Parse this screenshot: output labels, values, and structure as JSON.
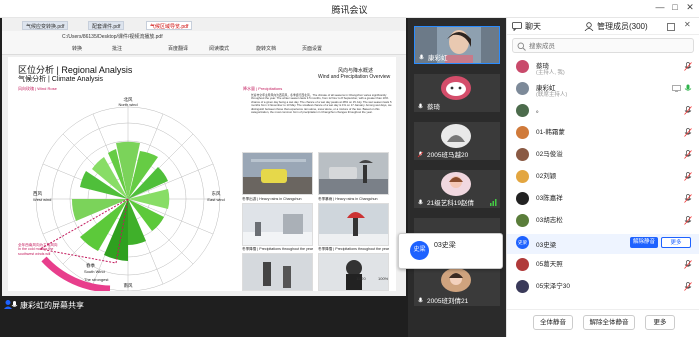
{
  "window": {
    "title": "腾讯会议"
  },
  "pdf": {
    "tabs": [
      "气候应变转换.pdf",
      "配套课件.pdf",
      "气候区域导览.pdf"
    ],
    "path": "C:/Users/86135/Desktop/课件/视频流播放.pdf",
    "toolbar_items": [
      "转换",
      "批注",
      "百度翻译",
      "阅读模式",
      "旋转文档",
      "页面设置"
    ],
    "page_number": "11/20",
    "zoom": "100%"
  },
  "page": {
    "title_cn_en": "区位分析 | Regional Analysis",
    "subtitle": "气候分析 | Climate Analysis",
    "wind_label": "风向玫瑰 | Wind Rose",
    "right_title_cn": "风向与降水概述",
    "right_title_en": "Wind and Precipitation Overview",
    "precip_label": "降水量 | Precipitations",
    "body_text": "长春市全年主导风向为西南风，冬季盛行西北风。The climate of all seasons in Changchun varies significantly throughout the year. The winter season lasts 3.5 months, from 12 Nov to 8 September, with a greater than 10% chance of a given day being a wet day. The chance of a wet day peaks at 48% on 15 July. The wet season lasts 5 months from 1 November to 13 May. The smallest chance of a wet day is 1% on 17 January. Among wet days, we distinguish between those that experience rain alone, snow alone, or a mixture of the two. Based on this categorization, the most common form of precipitation in Changchun changes throughout the year.",
    "compass": {
      "north": "北风",
      "north_en": "North wind",
      "east": "东风",
      "east_en": "East wind",
      "west": "西风",
      "west_en": "West wind",
      "south": "南风",
      "south_en": "South Wind",
      "strongest": "The strongest"
    },
    "wind_note": "全年西南风向为主导风向 In the cold months the southwest winds will",
    "spring": "春季",
    "photo_captions": [
      "冬季出游 | Heavy rains in Changchun",
      "冬季暴雨 | Heavy rains in Changchun",
      "冬季降雪 | Precipitations throughout the year",
      "冬季降雪 | Precipitations throughout the year",
      "春季大风 | Heavy snows in Changchun",
      "冬季大风 | Heavy snows in Changchun"
    ]
  },
  "presenter": {
    "label": "康彩虹的屏幕共享"
  },
  "video_tiles": [
    {
      "name": "康彩虹"
    },
    {
      "name": "蔡琦"
    },
    {
      "name": "2005班马越20"
    },
    {
      "name": "21级艺科19赵倩"
    },
    {
      "name": ""
    },
    {
      "name": "2005班刘倩21"
    }
  ],
  "speaker": {
    "avatar_text": "史梁",
    "name": "03史梁"
  },
  "panel": {
    "tab_chat": "聊天",
    "tab_members": "管理成员(300)",
    "search_placeholder": "搜索成员",
    "members": [
      {
        "name": "蔡琦",
        "sub": "(主持人, 我)"
      },
      {
        "name": "康彩虹",
        "sub": "(联席主持人)"
      },
      {
        "name": "。",
        "sub": ""
      },
      {
        "name": "01-韩霜蒙",
        "sub": ""
      },
      {
        "name": "02马俊溢",
        "sub": ""
      },
      {
        "name": "02刘颖",
        "sub": ""
      },
      {
        "name": "03陈嘉祥",
        "sub": ""
      },
      {
        "name": "03胡志松",
        "sub": ""
      },
      {
        "name": "03史梁",
        "sub": ""
      },
      {
        "name": "05葛天照",
        "sub": ""
      },
      {
        "name": "05宋泽宁30",
        "sub": ""
      }
    ],
    "unmute_button": "解除静音",
    "more_button": "更多",
    "footer": {
      "mute_all": "全体静音",
      "unmute_all": "解除全体静音",
      "more": "更多"
    }
  },
  "colors": {
    "accent": "#1e62ff",
    "wind_green": "#5cc93a",
    "pink": "#e83e8c",
    "dark_bg": "#1f1f1f"
  }
}
